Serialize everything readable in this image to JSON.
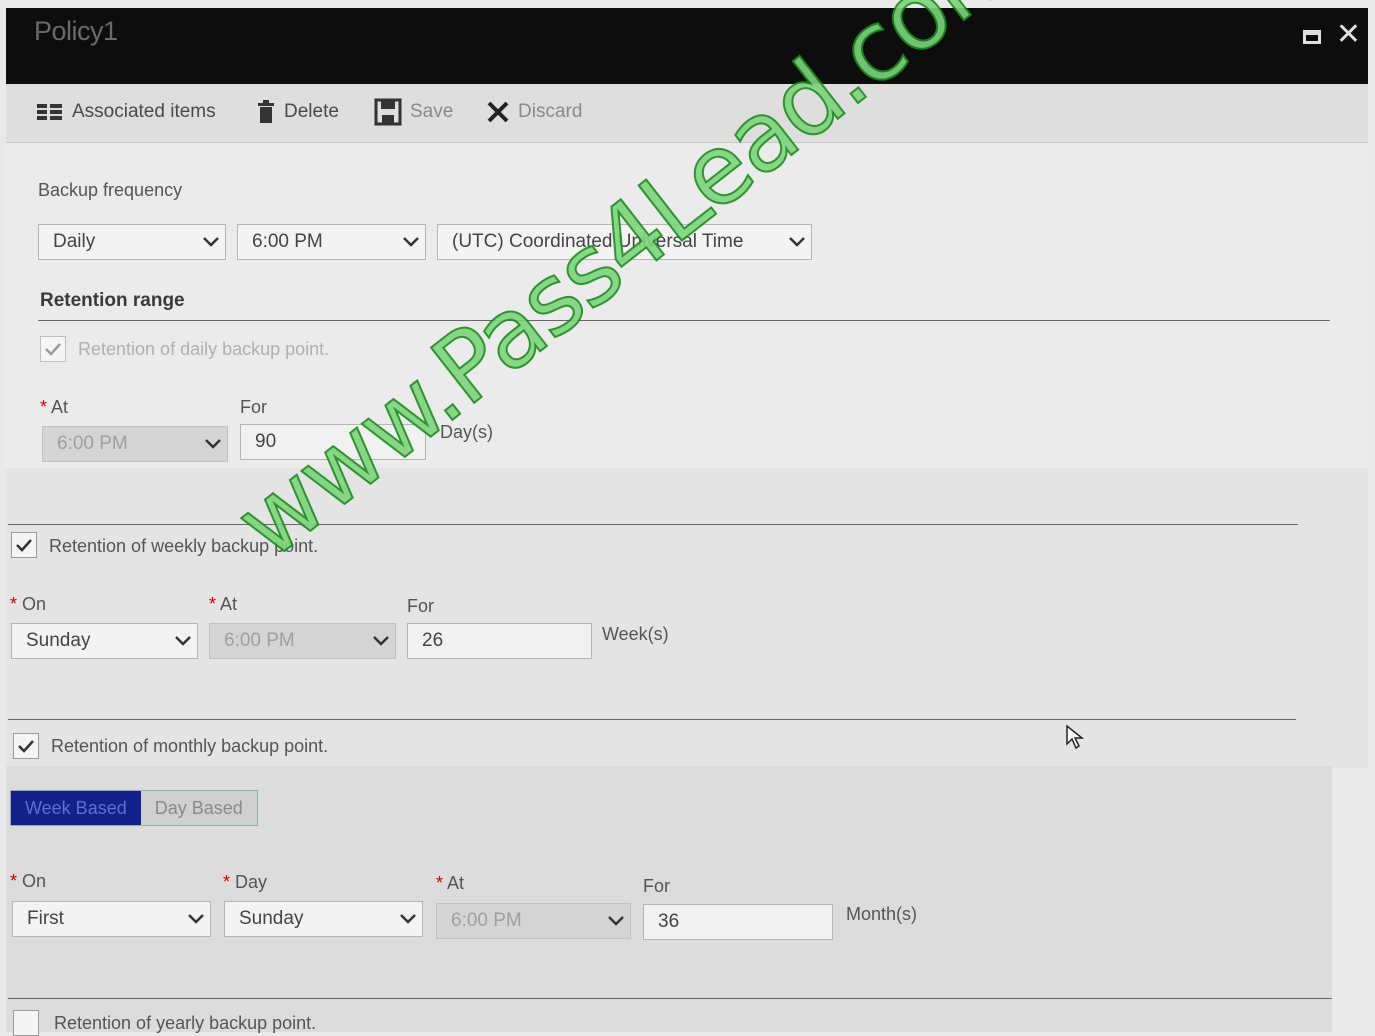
{
  "window": {
    "title": "Policy1"
  },
  "toolbar": {
    "associated_items": "Associated items",
    "delete": "Delete",
    "save": "Save",
    "discard": "Discard"
  },
  "backup_frequency": {
    "label": "Backup frequency",
    "frequency": "Daily",
    "time": "6:00 PM",
    "timezone": "(UTC) Coordinated Universal Time"
  },
  "retention": {
    "title": "Retention range",
    "daily": {
      "label": "Retention of daily backup point.",
      "checked": true,
      "at_label": "At",
      "at_value": "6:00 PM",
      "for_label": "For",
      "for_value": "90",
      "unit": "Day(s)"
    },
    "weekly": {
      "label": "Retention of weekly backup point.",
      "checked": true,
      "on_label": "On",
      "on_value": "Sunday",
      "at_label": "At",
      "at_value": "6:00 PM",
      "for_label": "For",
      "for_value": "26",
      "unit": "Week(s)"
    },
    "monthly": {
      "label": "Retention of monthly backup point.",
      "checked": true,
      "tabs": [
        "Week Based",
        "Day Based"
      ],
      "selected_tab": "Week Based",
      "on_label": "On",
      "on_value": "First",
      "day_label": "Day",
      "day_value": "Sunday",
      "at_label": "At",
      "at_value": "6:00 PM",
      "for_label": "For",
      "for_value": "36",
      "unit": "Month(s)"
    },
    "yearly": {
      "label": "Retention of yearly backup point.",
      "checked": false
    }
  },
  "watermark": "www.Pass4Lead.com"
}
